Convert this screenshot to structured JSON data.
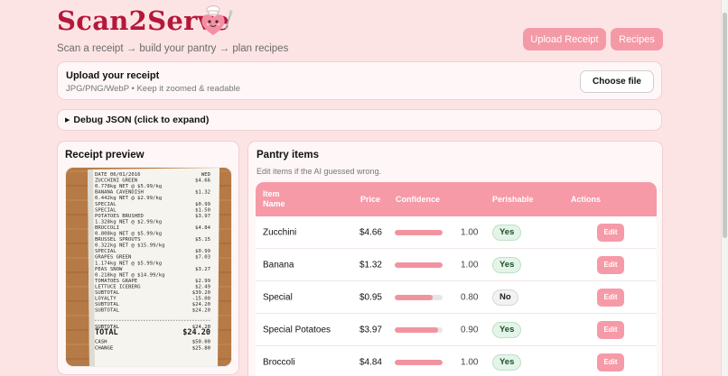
{
  "app": {
    "title": "Scan2Serve",
    "tagline": "Scan a receipt → build your pantry → plan recipes"
  },
  "nav": {
    "upload_label": "Upload Receipt",
    "recipes_label": "Recipes"
  },
  "upload": {
    "heading": "Upload your receipt",
    "hint": "JPG/PNG/WebP • Keep it zoomed & readable",
    "choose_label": "Choose file"
  },
  "debug": {
    "label": "Debug JSON (click to expand)"
  },
  "preview": {
    "heading": "Receipt preview",
    "receipt_lines": [
      {
        "l": "DATE      06/01/2016",
        "r": "WED"
      },
      {
        "l": "ZUCCHINI GREEN",
        "r": "$4.66"
      },
      {
        "l": " 0.778kg NET @ $5.99/kg",
        "r": ""
      },
      {
        "l": "BANANA CAVENDISH",
        "r": "$1.32"
      },
      {
        "l": " 0.442kg NET @ $2.99/kg",
        "r": ""
      },
      {
        "l": "SPECIAL",
        "r": "$0.99"
      },
      {
        "l": "SPECIAL",
        "r": "$1.50"
      },
      {
        "l": "POTATOES BRUSHED",
        "r": "$3.97"
      },
      {
        "l": " 1.328kg NET @ $2.99/kg",
        "r": ""
      },
      {
        "l": "BROCCOLI",
        "r": "$4.84"
      },
      {
        "l": " 0.808kg NET @ $5.99/kg",
        "r": ""
      },
      {
        "l": "BRUSSEL SPROUTS",
        "r": "$5.15"
      },
      {
        "l": " 0.322kg NET @ $15.99/kg",
        "r": ""
      },
      {
        "l": "SPECIAL",
        "r": "$0.99"
      },
      {
        "l": "GRAPES GREEN",
        "r": "$7.03"
      },
      {
        "l": " 1.174kg NET @ $5.99/kg",
        "r": ""
      },
      {
        "l": "PEAS SNOW",
        "r": "$3.27"
      },
      {
        "l": " 0.218kg NET @ $14.99/kg",
        "r": ""
      },
      {
        "l": "TOMATOES GRAPE",
        "r": "$2.99"
      },
      {
        "l": "LETTUCE ICEBERG",
        "r": "$2.49"
      },
      {
        "l": "          SUBTOTAL",
        "r": "$39.20"
      },
      {
        "l": "          LOYALTY",
        "r": "-15.00"
      },
      {
        "l": "          SUBTOTAL",
        "r": "$24.20"
      },
      {
        "l": "          SUBTOTAL",
        "r": "$24.20"
      }
    ],
    "summary_lines": [
      {
        "l": "SUBTOTAL",
        "r": "$24.20"
      },
      {
        "l": "TOTAL",
        "r": "$24.20"
      },
      {
        "l": "CASH",
        "r": "$50.00"
      },
      {
        "l": "CHANGE",
        "r": "$25.80"
      }
    ]
  },
  "pantry": {
    "heading": "Pantry items",
    "subtitle": "Edit items if the AI guessed wrong.",
    "columns": {
      "item": "Item Name",
      "price": "Price",
      "confidence": "Confidence",
      "perishable": "Perishable",
      "actions": "Actions"
    },
    "edit_label": "Edit",
    "items": [
      {
        "name": "Zucchini",
        "price": "$4.66",
        "confidence": "1.00",
        "confidence_value": 1.0,
        "perishable": "Yes"
      },
      {
        "name": "Banana",
        "price": "$1.32",
        "confidence": "1.00",
        "confidence_value": 1.0,
        "perishable": "Yes"
      },
      {
        "name": "Special",
        "price": "$0.95",
        "confidence": "0.80",
        "confidence_value": 0.8,
        "perishable": "No"
      },
      {
        "name": "Special Potatoes",
        "price": "$3.97",
        "confidence": "0.90",
        "confidence_value": 0.9,
        "perishable": "Yes"
      },
      {
        "name": "Broccoli",
        "price": "$4.84",
        "confidence": "1.00",
        "confidence_value": 1.0,
        "perishable": "Yes"
      }
    ]
  },
  "colors": {
    "brand": "#b5173a",
    "accent": "#f69aa8",
    "background": "#fde4e4"
  }
}
